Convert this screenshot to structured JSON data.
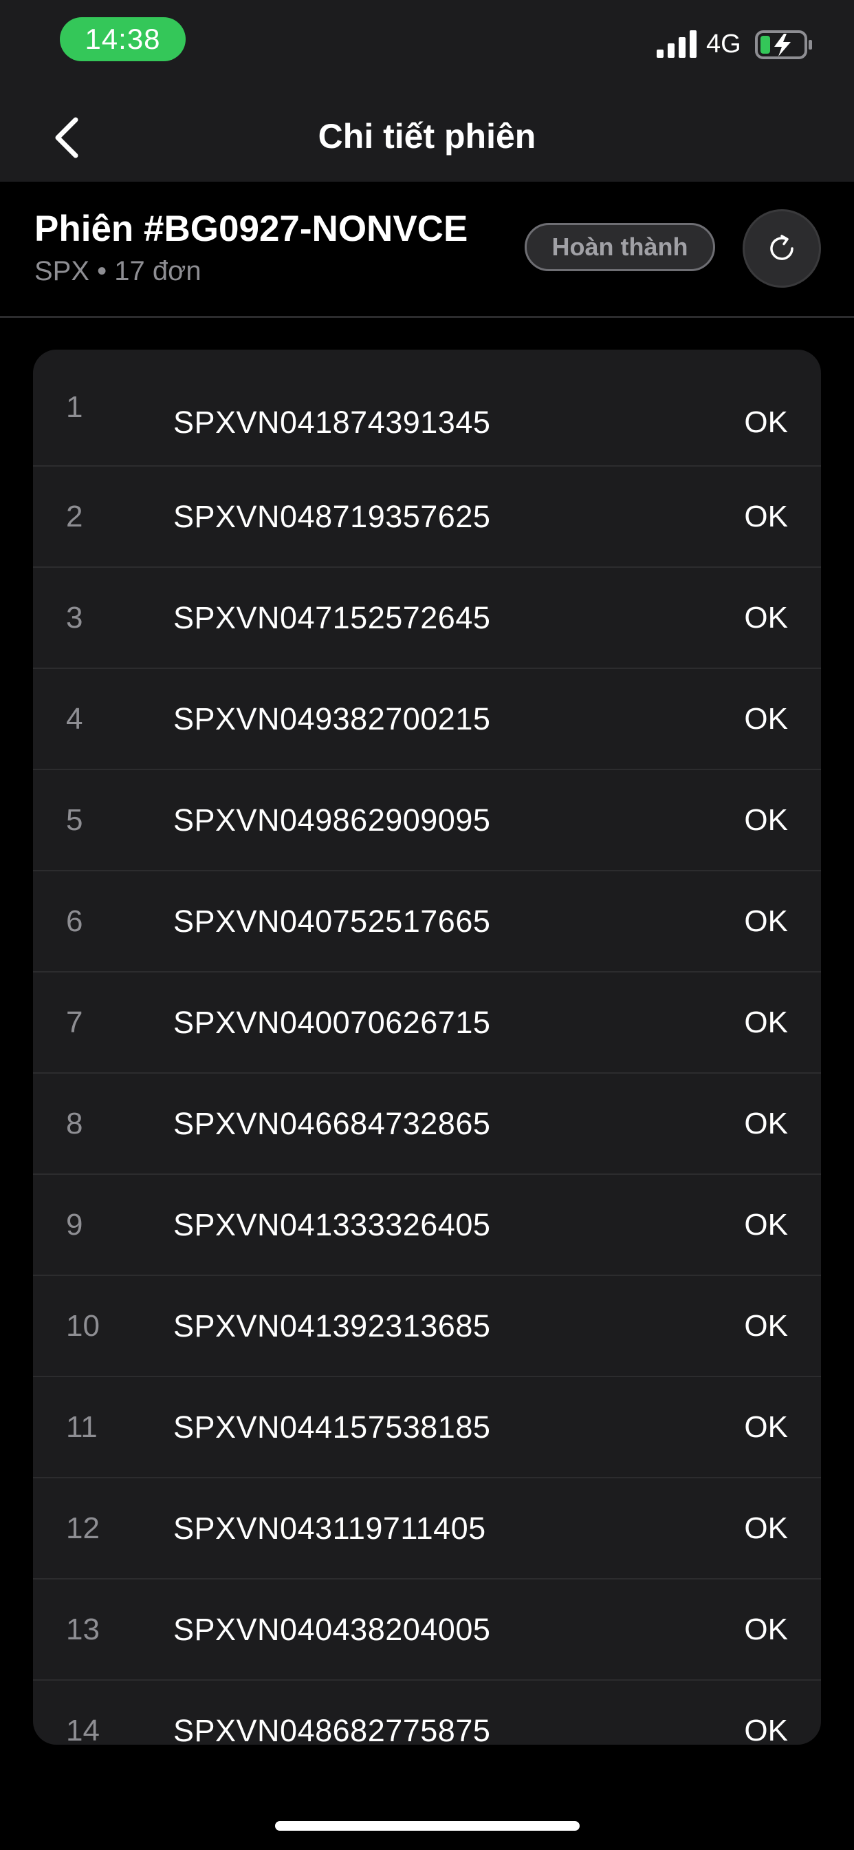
{
  "status_bar": {
    "time": "14:38",
    "network": "4G"
  },
  "nav": {
    "title": "Chi tiết phiên"
  },
  "session": {
    "title": "Phiên #BG0927-NONVCE",
    "subtitle": "SPX • 17 đơn",
    "status_label": "Hoàn thành"
  },
  "orders": [
    {
      "index": "1",
      "code": "SPXVN041874391345",
      "status": "OK"
    },
    {
      "index": "2",
      "code": "SPXVN048719357625",
      "status": "OK"
    },
    {
      "index": "3",
      "code": "SPXVN047152572645",
      "status": "OK"
    },
    {
      "index": "4",
      "code": "SPXVN049382700215",
      "status": "OK"
    },
    {
      "index": "5",
      "code": "SPXVN049862909095",
      "status": "OK"
    },
    {
      "index": "6",
      "code": "SPXVN040752517665",
      "status": "OK"
    },
    {
      "index": "7",
      "code": "SPXVN040070626715",
      "status": "OK"
    },
    {
      "index": "8",
      "code": "SPXVN046684732865",
      "status": "OK"
    },
    {
      "index": "9",
      "code": "SPXVN041333326405",
      "status": "OK"
    },
    {
      "index": "10",
      "code": "SPXVN041392313685",
      "status": "OK"
    },
    {
      "index": "11",
      "code": "SPXVN044157538185",
      "status": "OK"
    },
    {
      "index": "12",
      "code": "SPXVN043119711405",
      "status": "OK"
    },
    {
      "index": "13",
      "code": "SPXVN040438204005",
      "status": "OK"
    },
    {
      "index": "14",
      "code": "SPXVN048682775875",
      "status": "OK"
    }
  ],
  "icons": {
    "back": "chevron-left-icon",
    "refresh": "refresh-icon",
    "signal": "cellular-signal-icon",
    "battery": "battery-charging-icon"
  },
  "colors": {
    "accent_green": "#34c759",
    "surface": "#1c1c1e",
    "background": "#000000",
    "muted_text": "#8e8e93"
  }
}
